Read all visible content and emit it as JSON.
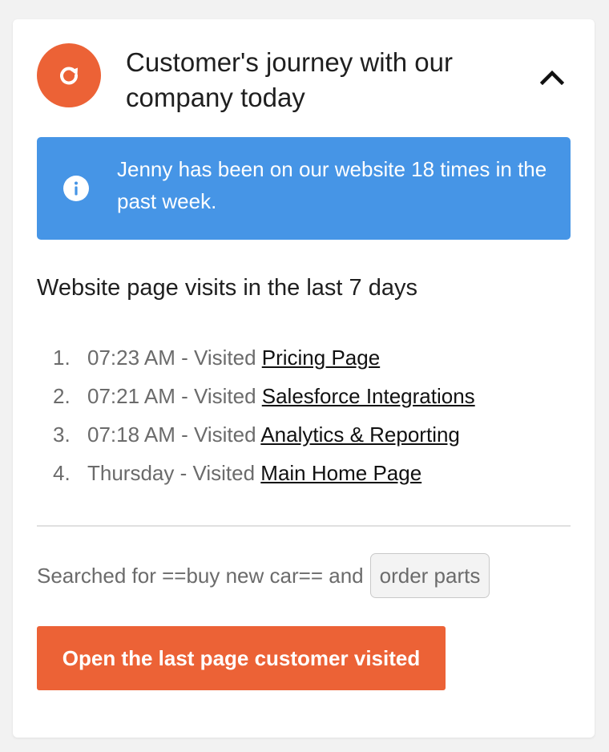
{
  "header": {
    "icon": "refresh-icon",
    "title": "Customer's journey with our company today",
    "toggle_icon": "chevron-up-icon"
  },
  "banner": {
    "icon": "info-icon",
    "text": "Jenny has been on our website 18 times in the past week."
  },
  "visits": {
    "heading": "Website page visits in the last 7 days",
    "items": [
      {
        "number": "1.",
        "time": "07:23 AM - Visited ",
        "page": "Pricing Page"
      },
      {
        "number": "2.",
        "time": "07:21 AM - Visited ",
        "page": "Salesforce Integrations"
      },
      {
        "number": "3.",
        "time": "07:18 AM - Visited ",
        "page": "Analytics & Reporting"
      },
      {
        "number": "4.",
        "time": "Thursday - Visited ",
        "page": "Main Home Page"
      }
    ]
  },
  "search": {
    "prefix": "Searched for ==buy new car== and",
    "tag": "order parts"
  },
  "cta": {
    "label": "Open the last page customer visited"
  },
  "colors": {
    "accent": "#ec6236",
    "info": "#4695e6"
  }
}
